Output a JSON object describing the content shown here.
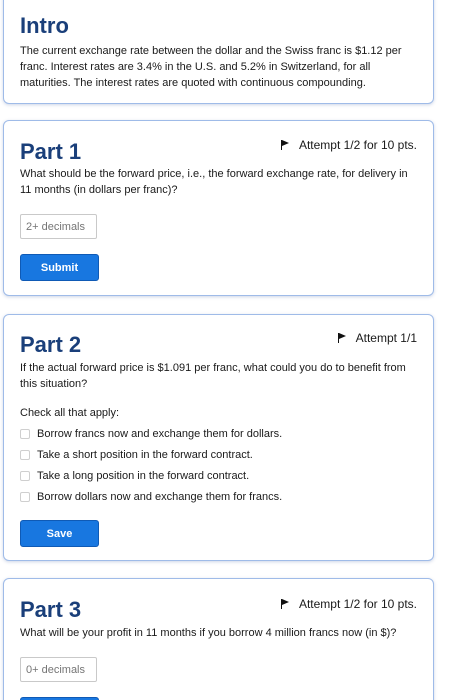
{
  "intro": {
    "title": "Intro",
    "text": "The current exchange rate between the dollar and the Swiss franc is $1.12 per franc. Interest rates are 3.4% in the U.S. and 5.2% in Switzerland, for all maturities. The interest rates are quoted with continuous compounding."
  },
  "part1": {
    "title": "Part 1",
    "attempt": "Attempt 1/2 for 10 pts.",
    "question": "What should be the forward price, i.e., the forward exchange rate, for delivery in 11 months (in dollars per franc)?",
    "input_placeholder": "2+ decimals",
    "submit_label": "Submit"
  },
  "part2": {
    "title": "Part 2",
    "attempt": "Attempt 1/1",
    "question": "If the actual forward price is $1.091 per franc, what could you do to benefit from this situation?",
    "instruction": "Check all that apply:",
    "options": [
      "Borrow francs now and exchange them for dollars.",
      "Take a short position in the forward contract.",
      "Take a long position in the forward contract.",
      "Borrow dollars now and exchange them for francs."
    ],
    "save_label": "Save"
  },
  "part3": {
    "title": "Part 3",
    "attempt": "Attempt 1/2 for 10 pts.",
    "question": "What will be your profit in 11 months if you borrow 4 million francs now (in $)?",
    "input_placeholder": "0+ decimals"
  }
}
